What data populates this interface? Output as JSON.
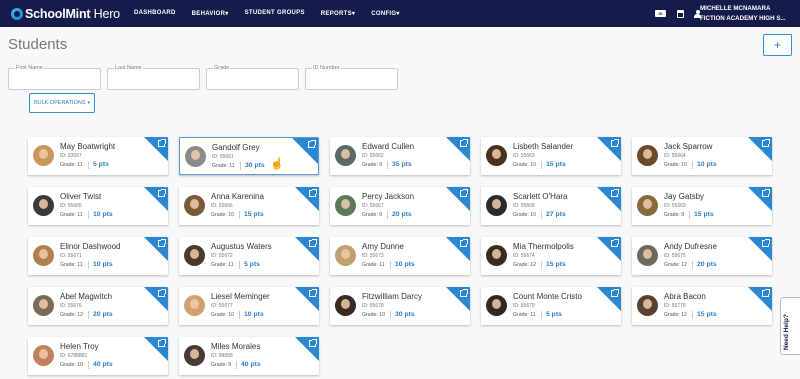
{
  "brand": {
    "name": "SchoolMint",
    "product": "Hero"
  },
  "nav": {
    "items": [
      "DASHBOARD",
      "BEHAVIOR",
      "STUDENT GROUPS",
      "REPORTS",
      "CONFIG"
    ],
    "dropdown_carets": [
      "",
      "▾",
      "",
      "▾",
      "▾"
    ],
    "icons": [
      "id-card-icon",
      "calendar-icon",
      "user-icon"
    ],
    "user_name": "MICHELLE MCNAMARA",
    "school": "FICTION ACADEMY HIGH S..."
  },
  "page": {
    "title": "Students",
    "add_label": "+"
  },
  "filters": {
    "first_name": "First Name",
    "last_name": "Last Name",
    "grade": "Grade",
    "id_number": "ID Number"
  },
  "bulk": {
    "label": "BULK OPERATIONS",
    "caret": "▾"
  },
  "students": [
    {
      "name": "May Boatwright",
      "id": "ID: 33567",
      "grade": "Grade: 11",
      "points": "5 pts",
      "avatar_color": "#c9955a"
    },
    {
      "name": "Gandolf Grey",
      "id": "ID: 55661",
      "grade": "Grade: 11",
      "points": "30 pts",
      "avatar_color": "#8a8a8a"
    },
    {
      "name": "Edward Cullen",
      "id": "ID: 55662",
      "grade": "Grade: 9",
      "points": "35 pts",
      "avatar_color": "#5a6a6a"
    },
    {
      "name": "Lisbeth Salander",
      "id": "ID: 55663",
      "grade": "Grade: 10",
      "points": "15 pts",
      "avatar_color": "#4a3020"
    },
    {
      "name": "Jack Sparrow",
      "id": "ID: 55664",
      "grade": "Grade: 10",
      "points": "10 pts",
      "avatar_color": "#6a4a2a"
    },
    {
      "name": "Oliver Twist",
      "id": "ID: 55665",
      "grade": "Grade: 11",
      "points": "10 pts",
      "avatar_color": "#3a3a3a"
    },
    {
      "name": "Anna Karenina",
      "id": "ID: 55666",
      "grade": "Grade: 10",
      "points": "15 pts",
      "avatar_color": "#7a5a3a"
    },
    {
      "name": "Percy Jackson",
      "id": "ID: 55667",
      "grade": "Grade: 9",
      "points": "20 pts",
      "avatar_color": "#5a7a5a"
    },
    {
      "name": "Scarlett O'Hara",
      "id": "ID: 55668",
      "grade": "Grade: 10",
      "points": "27 pts",
      "avatar_color": "#2a2a2a"
    },
    {
      "name": "Jay Gatsby",
      "id": "ID: 55669",
      "grade": "Grade: 9",
      "points": "15 pts",
      "avatar_color": "#8a6a3a"
    },
    {
      "name": "Elinor Dashwood",
      "id": "ID: 55671",
      "grade": "Grade: 11",
      "points": "10 pts",
      "avatar_color": "#b08050"
    },
    {
      "name": "Augustus Waters",
      "id": "ID: 55672",
      "grade": "Grade: 11",
      "points": "5 pts",
      "avatar_color": "#4a3a2a"
    },
    {
      "name": "Amy Dunne",
      "id": "ID: 55673",
      "grade": "Grade: 11",
      "points": "10 pts",
      "avatar_color": "#c0a070"
    },
    {
      "name": "Mia Thermolpolis",
      "id": "ID: 55674",
      "grade": "Grade: 12",
      "points": "15 pts",
      "avatar_color": "#3a2a20"
    },
    {
      "name": "Andy Dufresne",
      "id": "ID: 55675",
      "grade": "Grade: 12",
      "points": "20 pts",
      "avatar_color": "#6a6a5a"
    },
    {
      "name": "Abel Magwitch",
      "id": "ID: 55676",
      "grade": "Grade: 12",
      "points": "20 pts",
      "avatar_color": "#7a6a5a"
    },
    {
      "name": "Liesel Meminger",
      "id": "ID: 55677",
      "grade": "Grade: 10",
      "points": "10 pts",
      "avatar_color": "#d0a070"
    },
    {
      "name": "Fitzwilliam Darcy",
      "id": "ID: 55678",
      "grade": "Grade: 10",
      "points": "30 pts",
      "avatar_color": "#3a2a20"
    },
    {
      "name": "Count Monte Cristo",
      "id": "ID: 55679",
      "grade": "Grade: 11",
      "points": "5 pts",
      "avatar_color": "#2a2a2a"
    },
    {
      "name": "Abra Bacon",
      "id": "ID: 55778",
      "grade": "Grade: 12",
      "points": "15 pts",
      "avatar_color": "#5a4030"
    },
    {
      "name": "Helen Troy",
      "id": "ID: 6788881",
      "grade": "Grade: 10",
      "points": "40 pts",
      "avatar_color": "#c08060"
    },
    {
      "name": "Miles Morales",
      "id": "ID: 99888",
      "grade": "Grade: 9",
      "points": "40 pts",
      "avatar_color": "#4a3a3a"
    }
  ],
  "selected_student": "Gandolf Grey",
  "help": {
    "label": "Need Help?"
  },
  "colors": {
    "nav_bg": "#151c4b",
    "accent": "#2b87d1",
    "points": "#2a7cc7"
  }
}
